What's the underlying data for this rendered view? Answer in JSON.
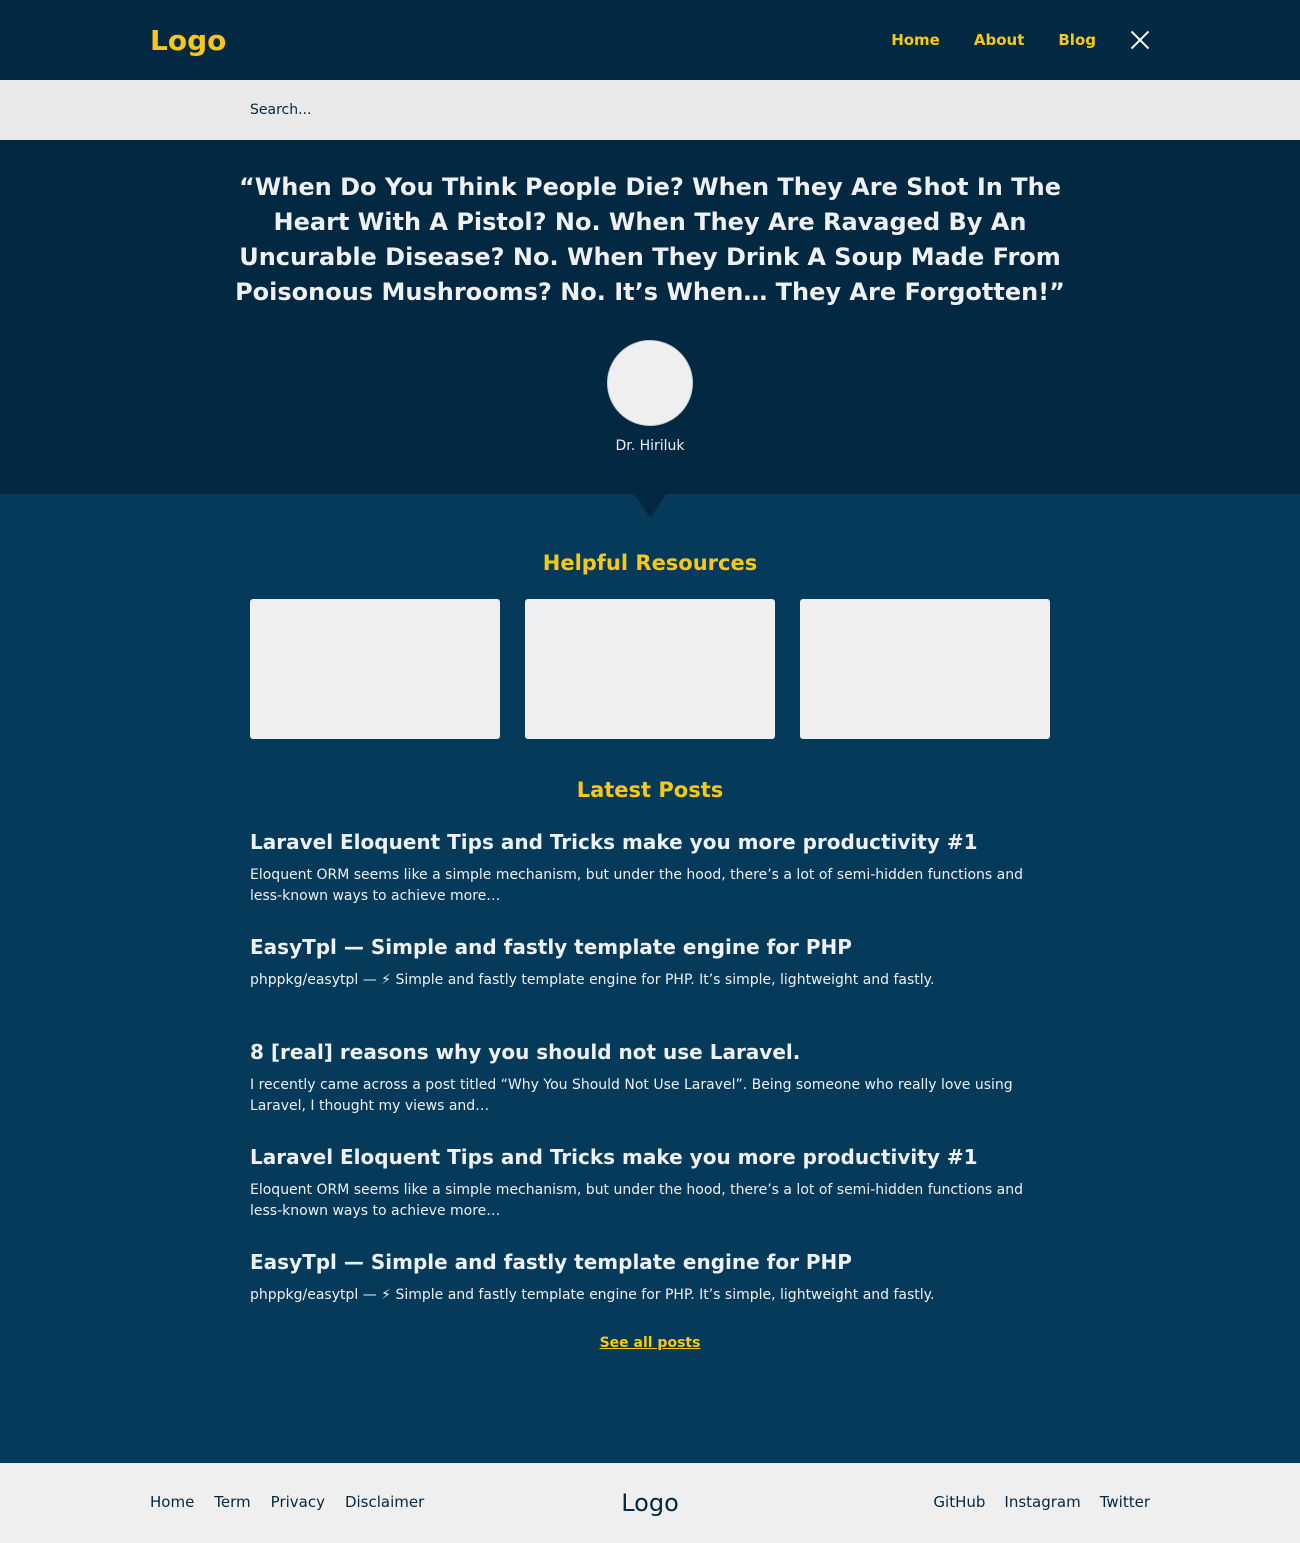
{
  "header": {
    "logo": "Logo",
    "nav": [
      {
        "label": "Home"
      },
      {
        "label": "About"
      },
      {
        "label": "Blog"
      }
    ],
    "close_icon": "close-icon"
  },
  "search": {
    "placeholder": "Search..."
  },
  "hero": {
    "quote": "“When Do You Think People Die? When They Are Shot In The Heart With A Pistol? No. When They Are Ravaged By An Uncurable Disease? No. When They Drink A Soup Made From Poisonous Mushrooms? No. It’s When… They Are Forgotten!”",
    "author": "Dr. Hiriluk"
  },
  "resources": {
    "title": "Helpful Resources"
  },
  "posts": {
    "title": "Latest Posts",
    "items": [
      {
        "title": "Laravel Eloquent Tips and Tricks make you more productivity #1",
        "excerpt": "Eloquent ORM seems like a simple mechanism, but under the hood, there’s a lot of semi-hidden functions and less-known ways to achieve more…"
      },
      {
        "title": "EasyTpl — Simple and fastly template engine for PHP",
        "excerpt": "phppkg/easytpl — ⚡ Simple and fastly template engine for PHP. It’s simple, lightweight and fastly."
      },
      {
        "title": "8 [real] reasons why you should not use Laravel.",
        "excerpt": "I recently came across a post titled “Why You Should Not Use Laravel”. Being someone who really love using Laravel, I thought my views and…"
      },
      {
        "title": "Laravel Eloquent Tips and Tricks make you more productivity #1",
        "excerpt": "Eloquent ORM seems like a simple mechanism, but under the hood, there’s a lot of semi-hidden functions and less-known ways to achieve more…"
      },
      {
        "title": "EasyTpl — Simple and fastly template engine for PHP",
        "excerpt": "phppkg/easytpl — ⚡ Simple and fastly template engine for PHP. It’s simple, lightweight and fastly."
      }
    ],
    "see_all": "See all posts"
  },
  "footer": {
    "left_links": [
      {
        "label": "Home"
      },
      {
        "label": "Term"
      },
      {
        "label": "Privacy"
      },
      {
        "label": "Disclaimer"
      }
    ],
    "logo": "Logo",
    "right_links": [
      {
        "label": "GitHub"
      },
      {
        "label": "Instagram"
      },
      {
        "label": "Twitter"
      }
    ]
  }
}
